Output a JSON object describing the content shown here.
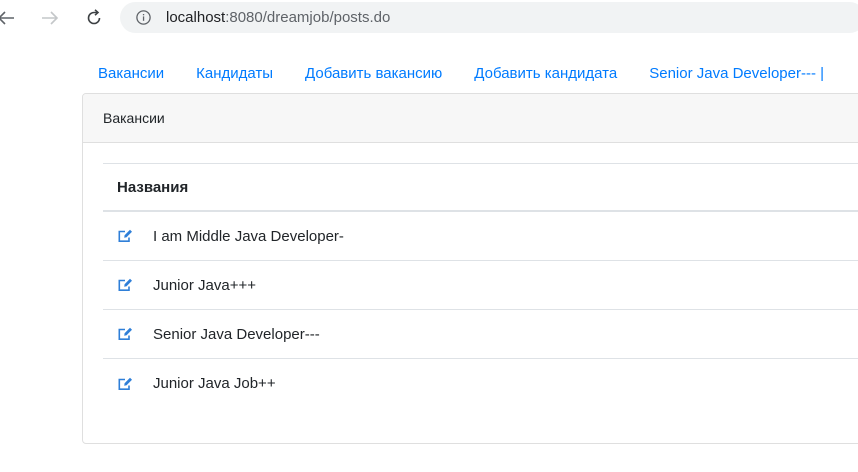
{
  "browser": {
    "url_host": "localhost",
    "url_path": ":8080/dreamjob/posts.do"
  },
  "nav": {
    "links": [
      "Вакансии",
      "Кандидаты",
      "Добавить вакансию",
      "Добавить кандидата",
      "Senior Java Developer--- |"
    ]
  },
  "card": {
    "header": "Вакансии",
    "column_header": "Названия",
    "rows": [
      "I am Middle Java Developer-",
      "Junior Java+++",
      "Senior Java Developer---",
      "Junior Java Job++"
    ]
  },
  "colors": {
    "link": "#007bff",
    "edit_icon": "#007bff"
  }
}
